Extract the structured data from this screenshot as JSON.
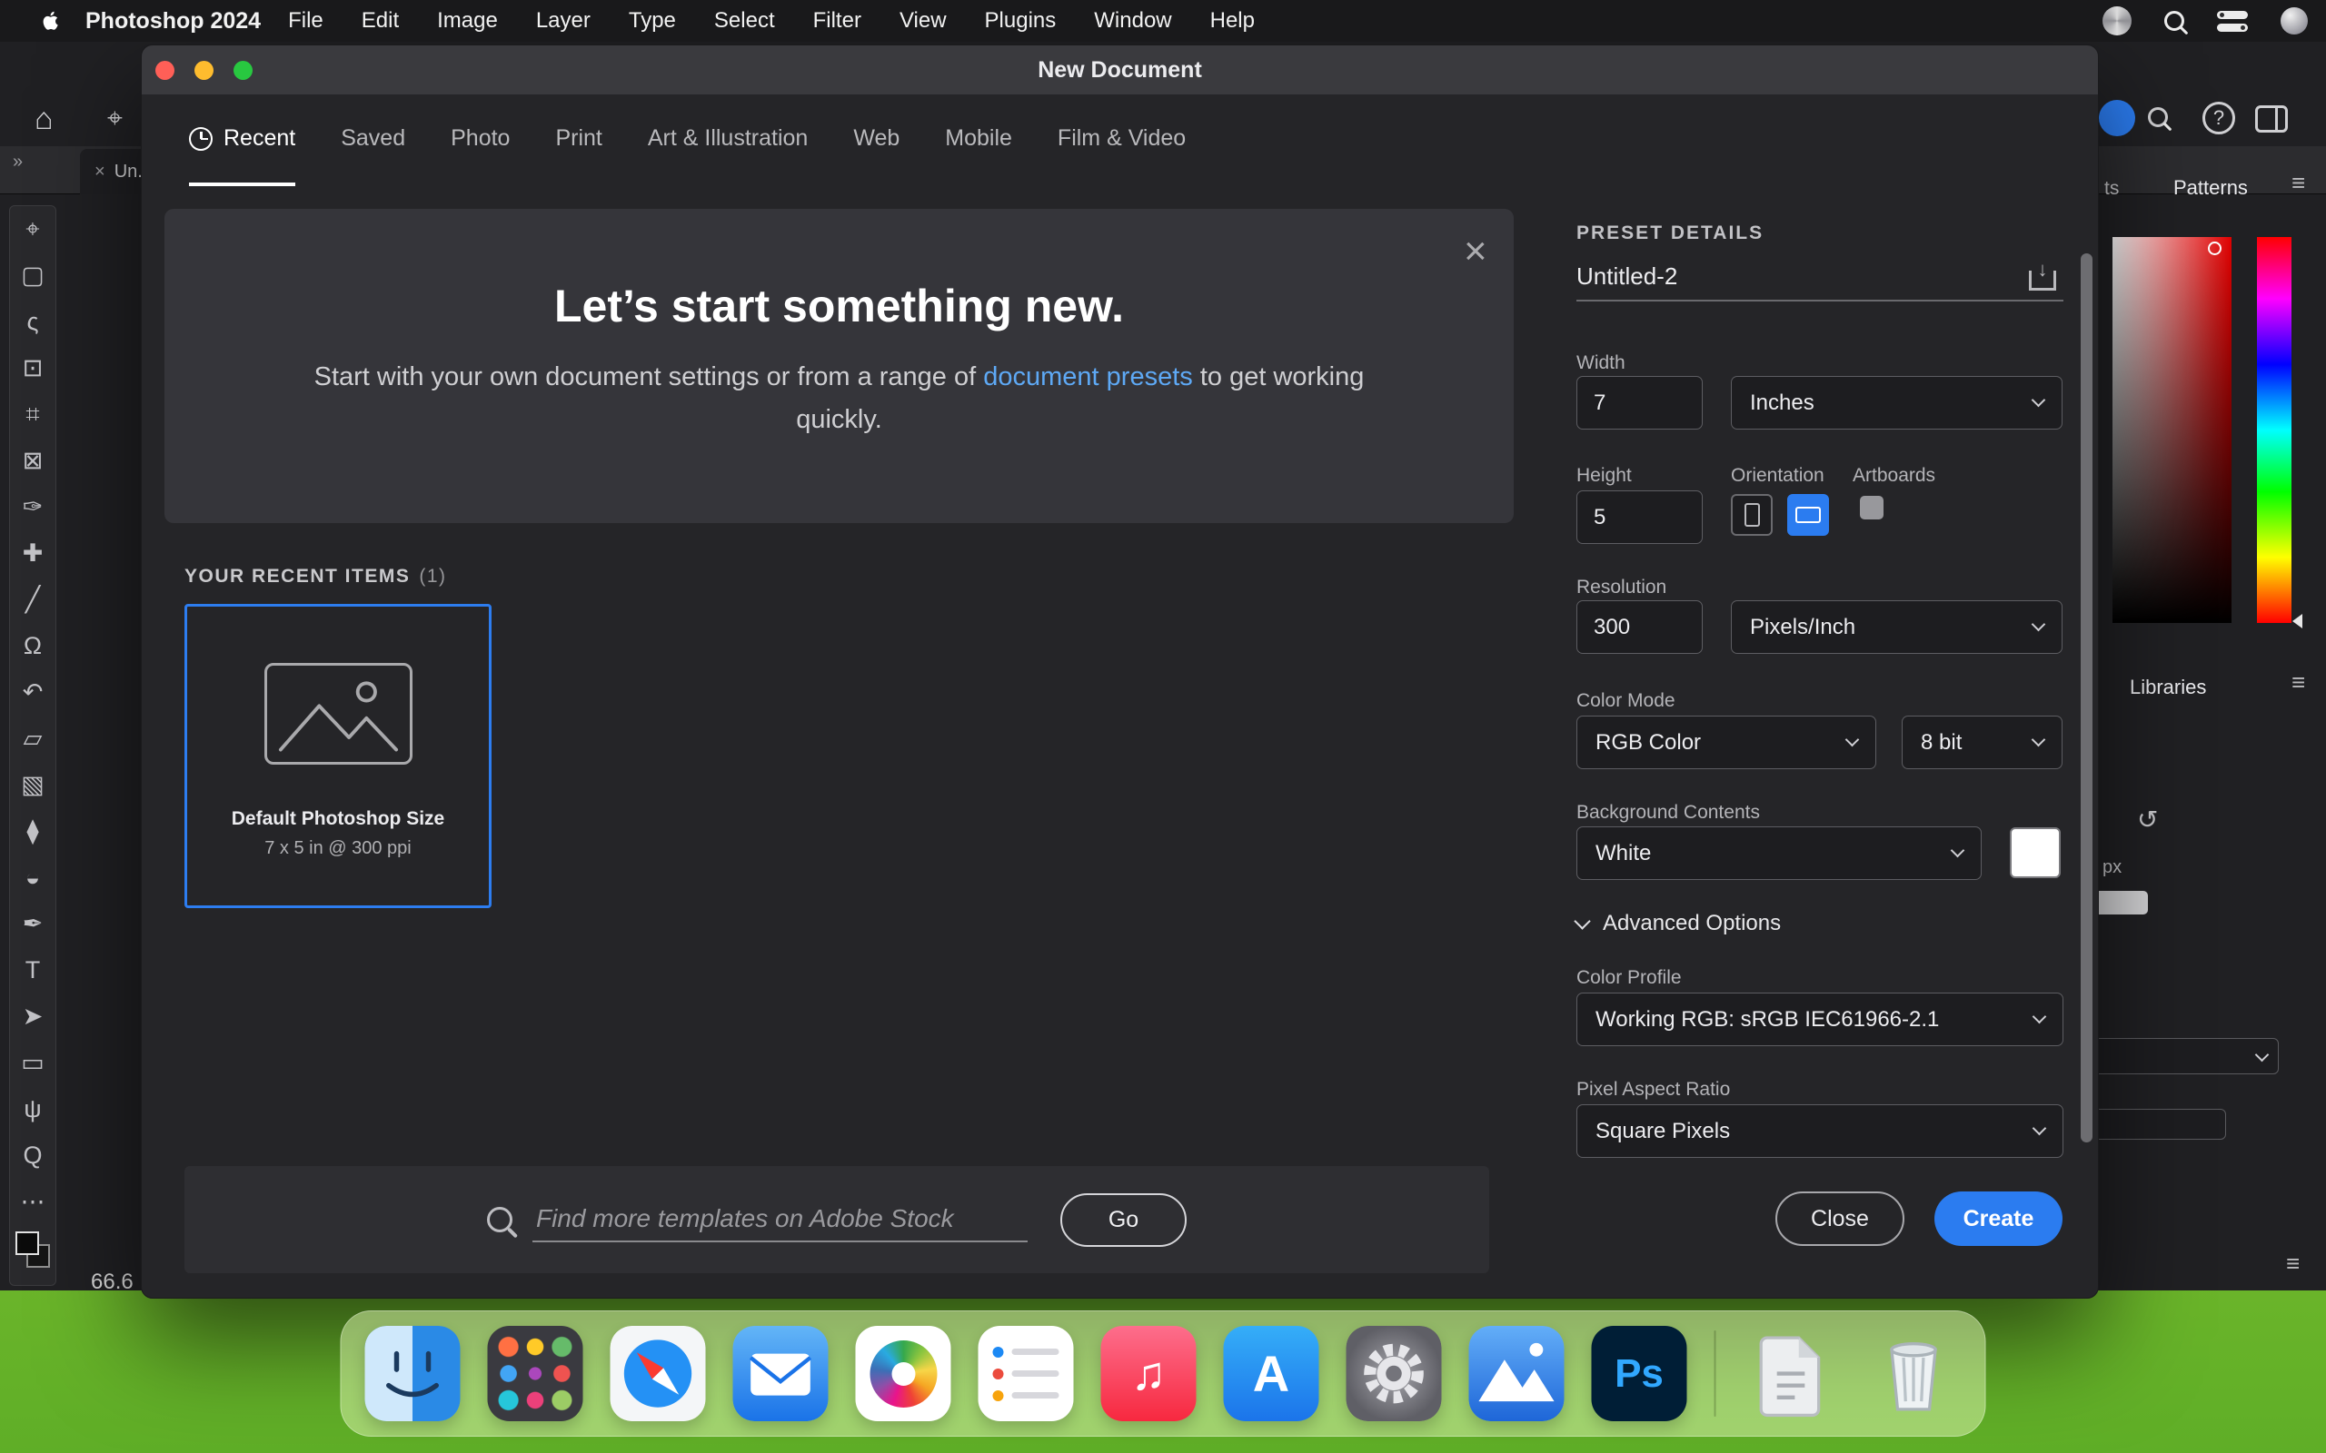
{
  "colors": {
    "accent_blue": "#2b7cf0",
    "link_blue": "#5ea9f5",
    "traffic_close": "#ff5f57",
    "traffic_minimize": "#febc2e",
    "traffic_zoom": "#28c840",
    "photoshop_brand": "#31a8ff"
  },
  "icons": {
    "close": "×",
    "hamburger": "≡",
    "reset": "↺",
    "home": "⌂",
    "move_options": "⌖",
    "download_arrow": "↓",
    "double_chevron": "»",
    "question": "?",
    "music_note": "♫",
    "appstore_a": "A",
    "photoshop_ps": "Ps"
  },
  "menu_bar": {
    "app_name": "Photoshop 2024",
    "items": [
      "File",
      "Edit",
      "Image",
      "Layer",
      "Type",
      "Select",
      "Filter",
      "View",
      "Plugins",
      "Window",
      "Help"
    ]
  },
  "dialog": {
    "title": "New Document",
    "tabs": [
      {
        "label": "Recent",
        "active": true,
        "has_icon": true
      },
      {
        "label": "Saved"
      },
      {
        "label": "Photo"
      },
      {
        "label": "Print"
      },
      {
        "label": "Art & Illustration"
      },
      {
        "label": "Web"
      },
      {
        "label": "Mobile"
      },
      {
        "label": "Film & Video"
      }
    ],
    "hero": {
      "title": "Let’s start something new.",
      "subtitle_before": "Start with your own document settings or from a range of ",
      "subtitle_link": "document presets",
      "subtitle_after": " to get working quickly."
    },
    "recent_section": {
      "label": "YOUR RECENT ITEMS",
      "count": "(1)"
    },
    "recent_items": [
      {
        "title": "Default Photoshop Size",
        "subtitle": "7 x 5 in @ 300 ppi"
      }
    ],
    "stock_search": {
      "placeholder": "Find more templates on Adobe Stock",
      "go_label": "Go"
    },
    "preset_details": {
      "heading": "PRESET DETAILS",
      "name_value": "Untitled-2",
      "width_label": "Width",
      "width_value": "7",
      "width_unit": "Inches",
      "height_label": "Height",
      "height_value": "5",
      "orientation_label": "Orientation",
      "artboards_label": "Artboards",
      "resolution_label": "Resolution",
      "resolution_value": "300",
      "resolution_unit": "Pixels/Inch",
      "color_mode_label": "Color Mode",
      "color_mode_value": "RGB Color",
      "bit_depth_value": "8 bit",
      "background_label": "Background Contents",
      "background_value": "White",
      "advanced_label": "Advanced Options",
      "color_profile_label": "Color Profile",
      "color_profile_value": "Working RGB: sRGB IEC61966-2.1",
      "pixel_aspect_label": "Pixel Aspect Ratio",
      "pixel_aspect_value": "Square Pixels",
      "close_label": "Close",
      "create_label": "Create"
    }
  },
  "photoshop": {
    "document_tab": "Un...",
    "zoom_level": "66.6",
    "panel_tabs": {
      "partial_left": "ts",
      "patterns": "Patterns",
      "libraries": "Libraries"
    },
    "px_label": "px",
    "tools": [
      {
        "name": "move-tool",
        "glyph": "⌖"
      },
      {
        "name": "marquee-tool",
        "glyph": "▢"
      },
      {
        "name": "lasso-tool",
        "glyph": "ς"
      },
      {
        "name": "object-selection-tool",
        "glyph": "⊡"
      },
      {
        "name": "crop-tool",
        "glyph": "⌗"
      },
      {
        "name": "frame-tool",
        "glyph": "⊠"
      },
      {
        "name": "eyedropper-tool",
        "glyph": "✑"
      },
      {
        "name": "healing-brush-tool",
        "glyph": "✚"
      },
      {
        "name": "brush-tool",
        "glyph": "╱"
      },
      {
        "name": "clone-stamp-tool",
        "glyph": "Ω"
      },
      {
        "name": "history-brush-tool",
        "glyph": "↶"
      },
      {
        "name": "eraser-tool",
        "glyph": "▱"
      },
      {
        "name": "gradient-tool",
        "glyph": "▧"
      },
      {
        "name": "blur-tool",
        "glyph": "⧫"
      },
      {
        "name": "dodge-tool",
        "glyph": "◒"
      },
      {
        "name": "pen-tool",
        "glyph": "✒"
      },
      {
        "name": "type-tool",
        "glyph": "T"
      },
      {
        "name": "path-selection-tool",
        "glyph": "➤"
      },
      {
        "name": "rectangle-tool",
        "glyph": "▭"
      },
      {
        "name": "hand-tool",
        "glyph": "ψ"
      },
      {
        "name": "zoom-tool",
        "glyph": "Q"
      },
      {
        "name": "edit-toolbar",
        "glyph": "⋯"
      }
    ]
  },
  "dock": {
    "apps": [
      "finder",
      "launchpad",
      "safari",
      "mail",
      "photos",
      "reminders",
      "music",
      "app-store",
      "system-settings",
      "photos-blue-app",
      "photoshop",
      "document",
      "trash"
    ]
  }
}
